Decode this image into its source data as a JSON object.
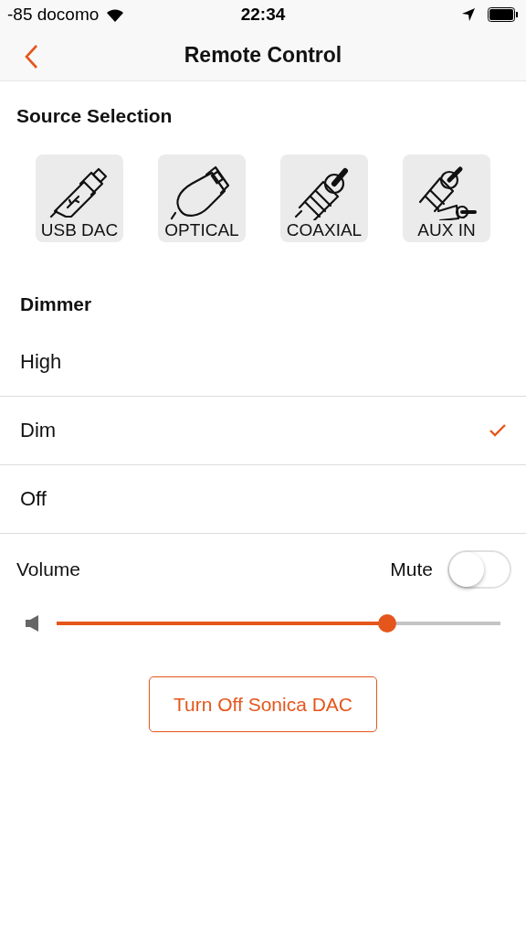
{
  "status_bar": {
    "carrier": "-85 docomo",
    "time": "22:34"
  },
  "nav": {
    "title": "Remote Control"
  },
  "source_selection": {
    "heading": "Source Selection",
    "sources": [
      {
        "kind": "usb",
        "label": "USB DAC"
      },
      {
        "kind": "optical",
        "label": "OPTICAL"
      },
      {
        "kind": "coaxial",
        "label": "COAXIAL"
      },
      {
        "kind": "aux",
        "label": "AUX IN"
      }
    ]
  },
  "dimmer": {
    "heading": "Dimmer",
    "options": [
      {
        "label": "High",
        "selected": false
      },
      {
        "label": "Dim",
        "selected": true
      },
      {
        "label": "Off",
        "selected": false
      }
    ]
  },
  "volume": {
    "label": "Volume",
    "mute_label": "Mute",
    "mute_on": false,
    "level": 0.744
  },
  "power_button": "Turn Off Sonica DAC"
}
